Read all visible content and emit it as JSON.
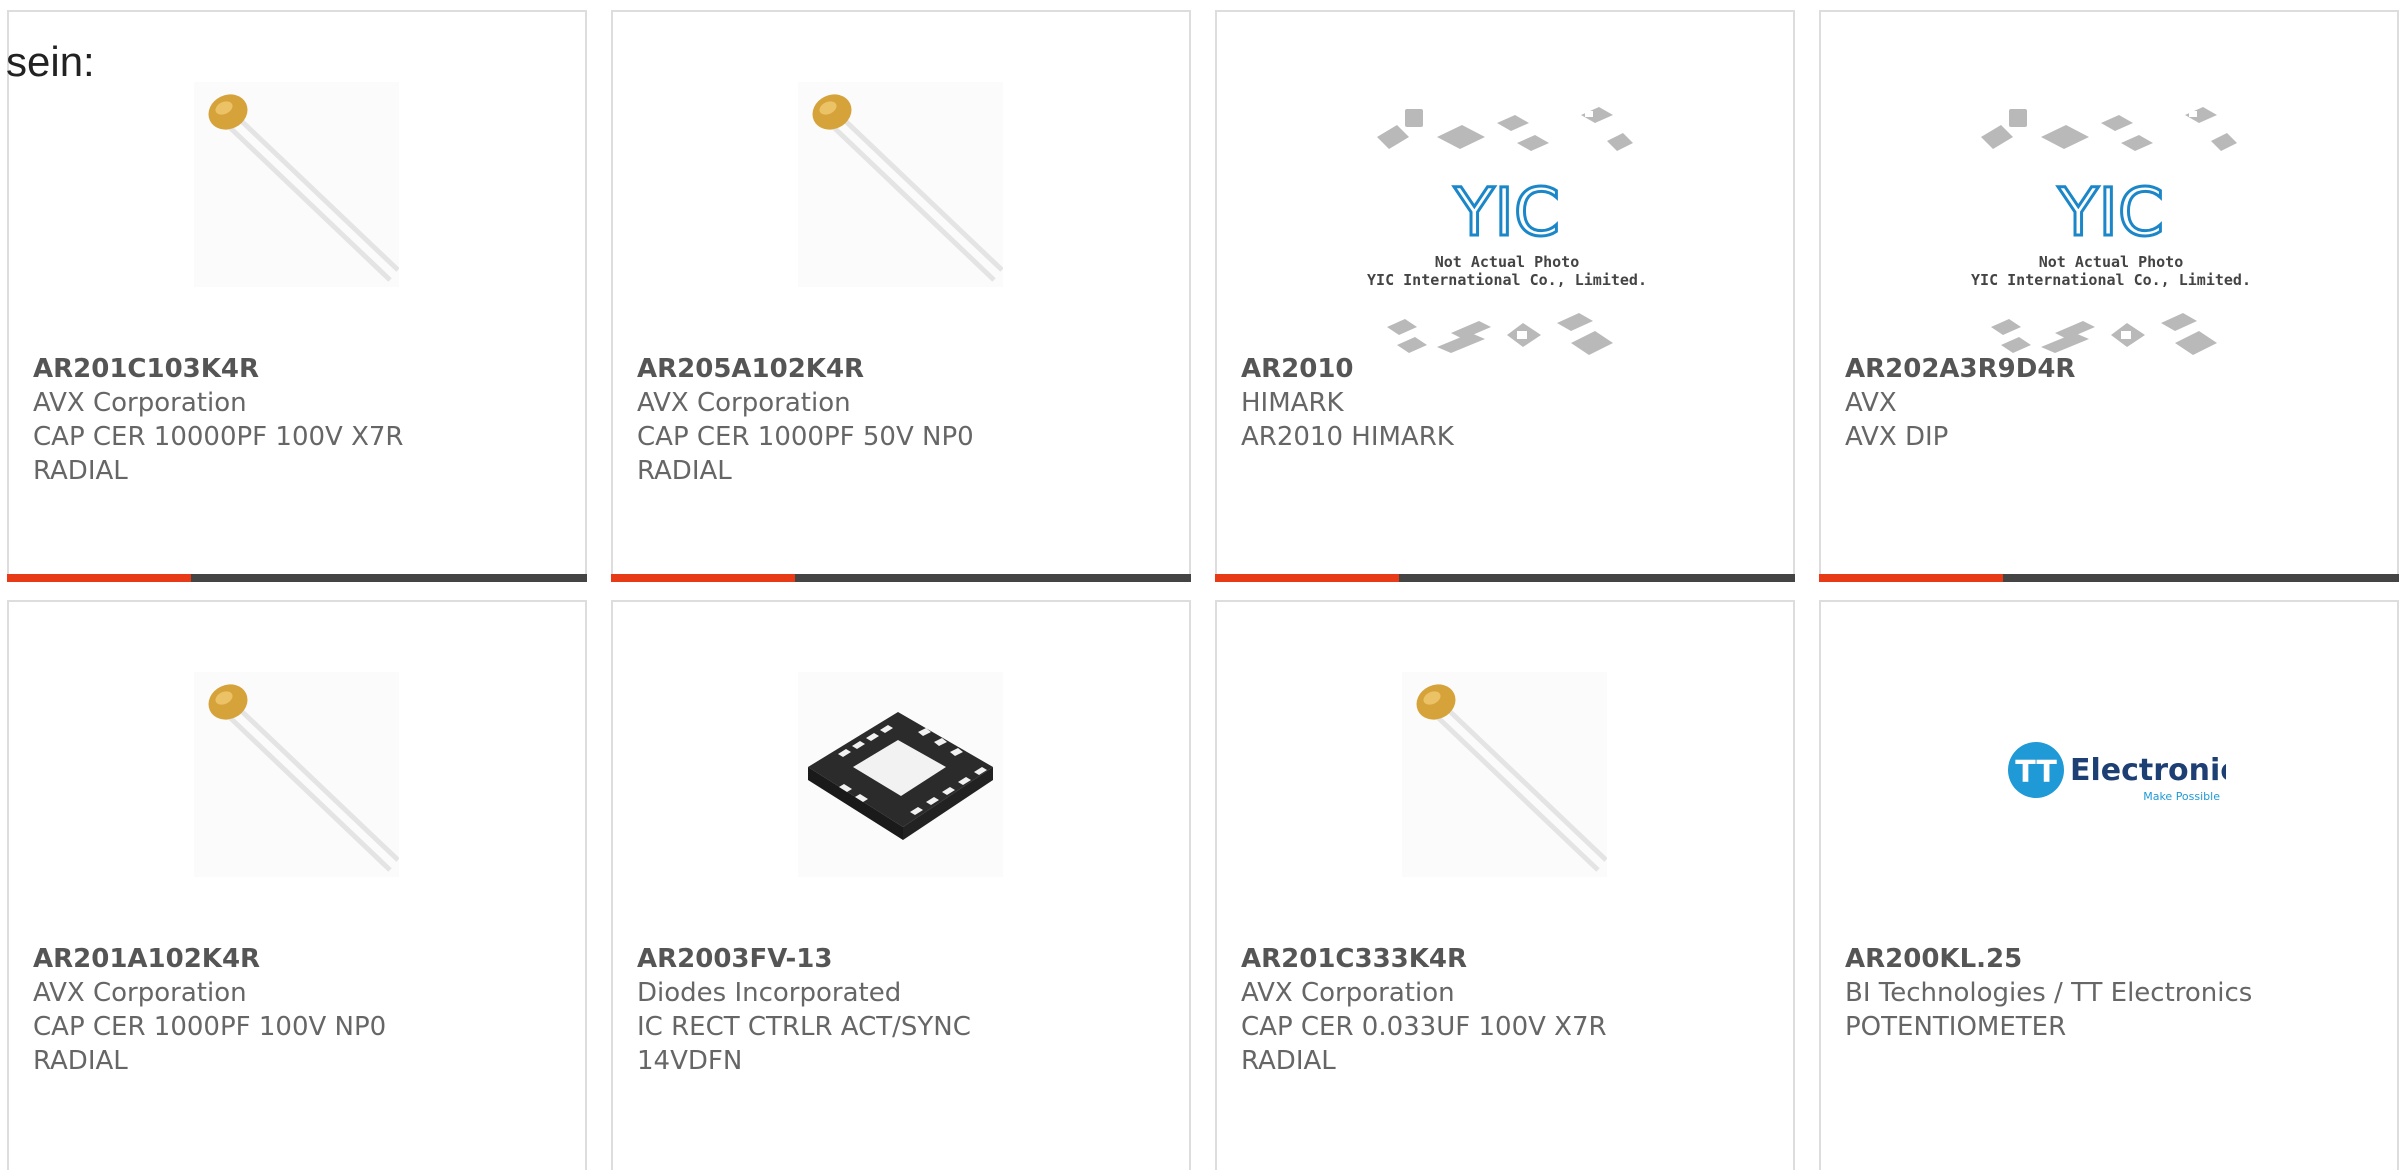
{
  "lead_text": "sein:",
  "products": [
    {
      "part": "AR201C103K4R",
      "maker": "AVX Corporation",
      "lines": [
        "CAP CER 10000PF 100V X7R",
        "RADIAL"
      ],
      "image": "ceramic-capacitor-image"
    },
    {
      "part": "AR205A102K4R",
      "maker": "AVX Corporation",
      "lines": [
        "CAP CER 1000PF 50V NP0",
        "RADIAL"
      ],
      "image": "ceramic-capacitor-image"
    },
    {
      "part": "AR2010",
      "maker": "HIMARK",
      "lines": [
        "AR2010 HIMARK",
        ""
      ],
      "image": "yic-placeholder-image",
      "placeholder_lines": [
        "Not Actual Photo",
        "YIC International Co., Limited."
      ],
      "placeholder_logo": "YIC"
    },
    {
      "part": "AR202A3R9D4R",
      "maker": "AVX",
      "lines": [
        "AVX DIP",
        ""
      ],
      "image": "yic-placeholder-image",
      "placeholder_lines": [
        "Not Actual Photo",
        "YIC International Co., Limited."
      ],
      "placeholder_logo": "YIC"
    },
    {
      "part": "AR201A102K4R",
      "maker": "AVX Corporation",
      "lines": [
        "CAP CER 1000PF 100V NP0",
        "RADIAL"
      ],
      "image": "ceramic-capacitor-image"
    },
    {
      "part": "AR2003FV-13",
      "maker": "Diodes Incorporated",
      "lines": [
        "IC RECT CTRLR ACT/SYNC",
        "14VDFN"
      ],
      "image": "dfn-chip-image"
    },
    {
      "part": "AR201C333K4R",
      "maker": "AVX Corporation",
      "lines": [
        "CAP CER 0.033UF 100V X7R",
        "RADIAL"
      ],
      "image": "ceramic-capacitor-image"
    },
    {
      "part": "AR200KL.25",
      "maker": "BI Technologies / TT Electronics",
      "lines": [
        "POTENTIOMETER",
        ""
      ],
      "image": "tt-electronics-logo",
      "logo_badge": "TT",
      "logo_name": "Electronics",
      "logo_tagline": "Make Possible"
    }
  ],
  "colors": {
    "accent": "#e63b16",
    "bar_dark": "#444444",
    "text": "#555555",
    "border": "#dddddd",
    "yic_blue": "#1b86c8"
  }
}
